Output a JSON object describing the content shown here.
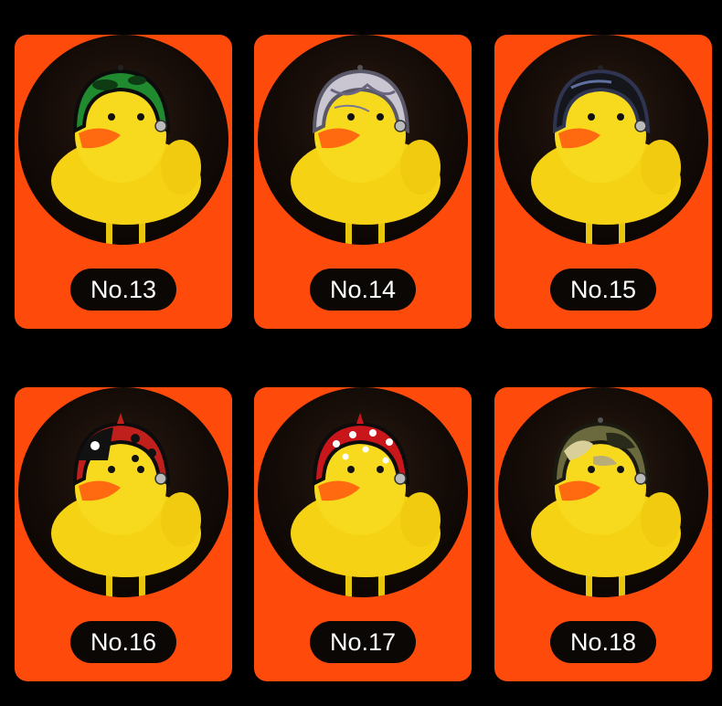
{
  "products": [
    {
      "label": "No.13",
      "helmet": "green-watermelon-helmet",
      "helmet_color": "#1f8a2e"
    },
    {
      "label": "No.14",
      "helmet": "white-marble-helmet",
      "helmet_color": "#c9c6d2"
    },
    {
      "label": "No.15",
      "helmet": "black-glossy-helmet",
      "helmet_color": "#15151c"
    },
    {
      "label": "No.16",
      "helmet": "ladybug-helmet",
      "helmet_color": "#c0201c"
    },
    {
      "label": "No.17",
      "helmet": "red-polka-dot-helmet",
      "helmet_color": "#c8161a"
    },
    {
      "label": "No.18",
      "helmet": "camouflage-helmet",
      "helmet_color": "#6b6a3e"
    }
  ],
  "colors": {
    "background": "#000000",
    "card": "#fe4a0a",
    "duck": "#f5d214",
    "beak": "#ff6a10",
    "label_bg": "#0a0705",
    "label_text": "#ffffff"
  }
}
